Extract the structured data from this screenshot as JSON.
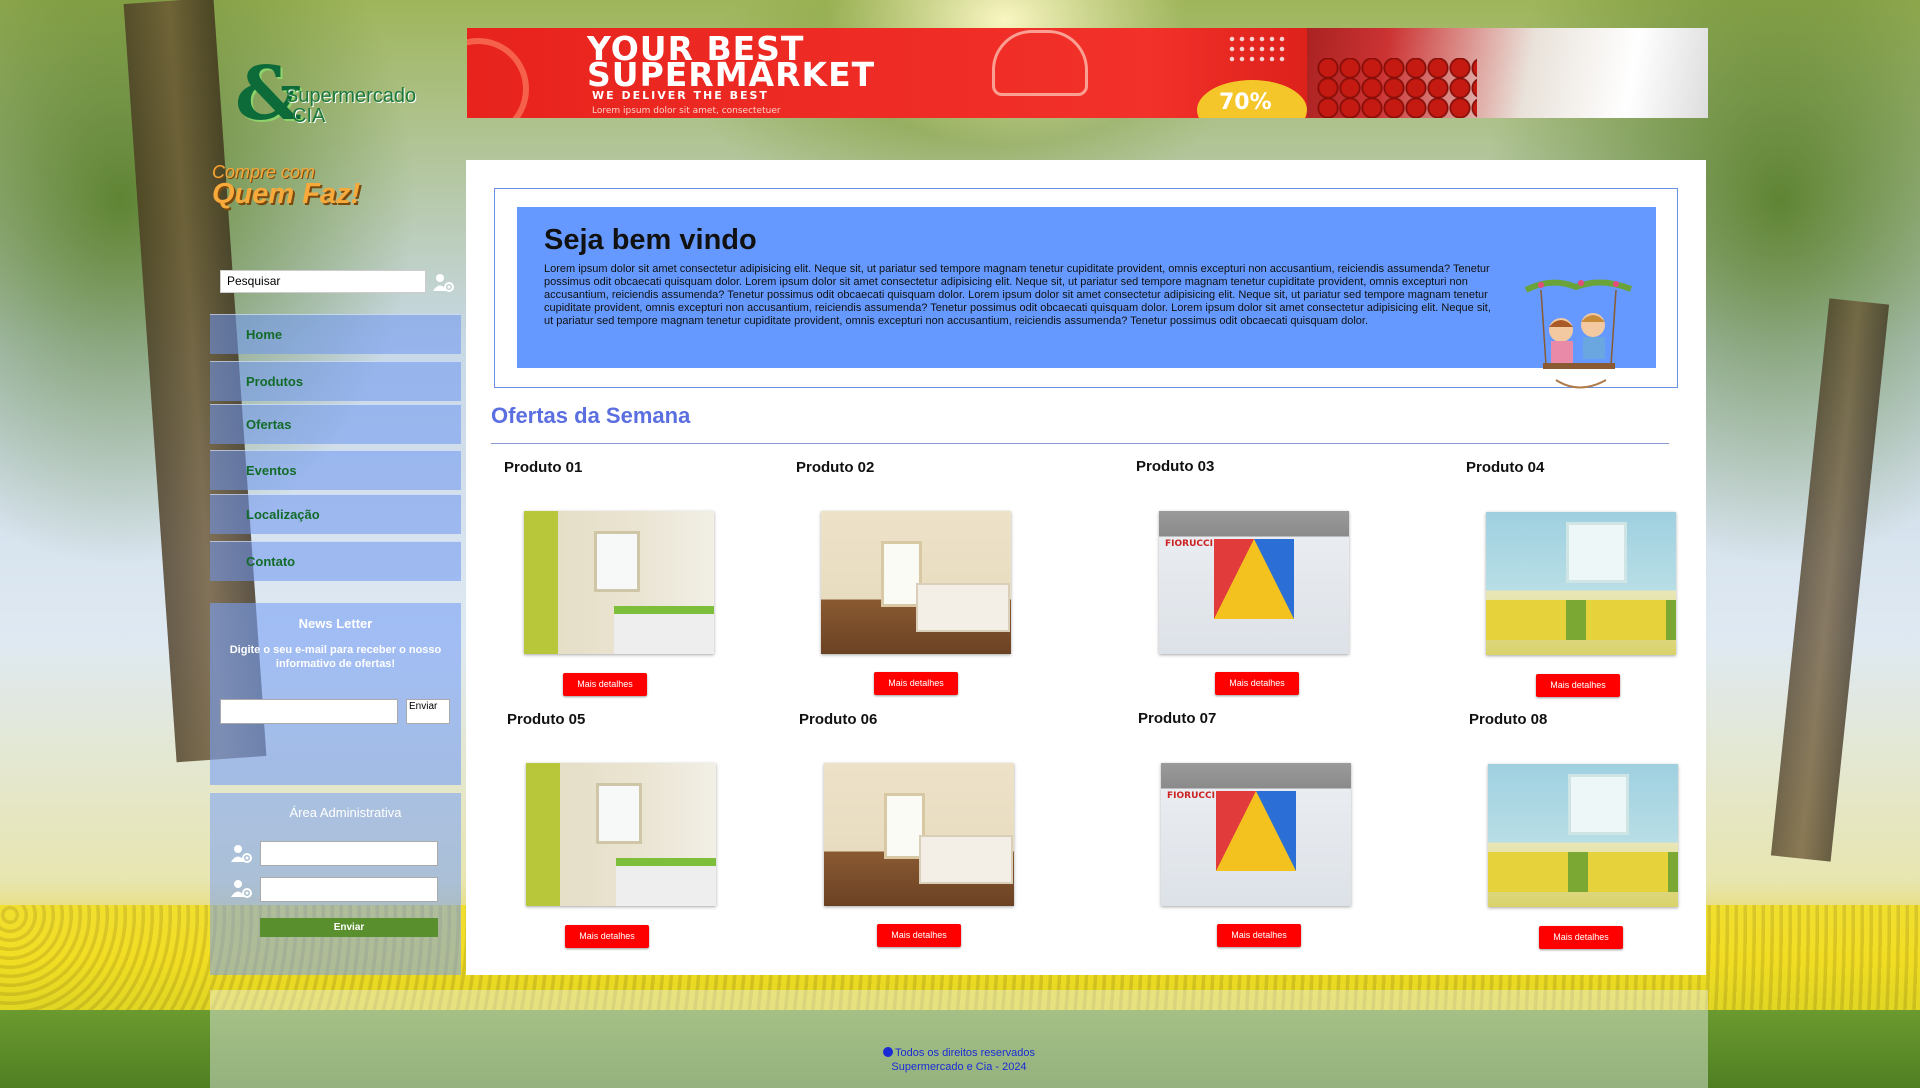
{
  "brand": {
    "logo_symbol": "&",
    "name_line1": "Supermercado",
    "name_line2": "CIA",
    "slogan_line1": "Compre com",
    "slogan_line2": "Quem Faz!"
  },
  "banner": {
    "line1": "YOUR BEST",
    "line2": "SUPERMARKET",
    "line3": "WE DELIVER THE BEST",
    "line4": "Lorem ipsum dolor sit amet, consectetuer",
    "badge": "70%"
  },
  "search": {
    "value": "Pesquisar",
    "icon": "search-icon"
  },
  "nav": {
    "items": [
      {
        "label": "Home"
      },
      {
        "label": "Produtos"
      },
      {
        "label": "Ofertas"
      },
      {
        "label": "Eventos"
      },
      {
        "label": "Localização"
      },
      {
        "label": "Contato"
      }
    ]
  },
  "newsletter": {
    "title": "News Letter",
    "text": "Digite o seu e-mail para receber o nosso informativo de ofertas!",
    "button": "Enviar"
  },
  "admin": {
    "title": "Área Administrativa",
    "button": "Enviar",
    "icon": "user-gear-icon"
  },
  "welcome": {
    "title": "Seja bem vindo",
    "text": "Lorem ipsum dolor sit amet consectetur adipisicing elit. Neque sit, ut pariatur sed tempore magnam tenetur cupiditate provident, omnis excepturi non accusantium, reiciendis assumenda? Tenetur possimus odit obcaecati quisquam dolor. Lorem ipsum dolor sit amet consectetur adipisicing elit. Neque sit, ut pariatur sed tempore magnam tenetur cupiditate provident, omnis excepturi non accusantium, reiciendis assumenda? Tenetur possimus odit obcaecati quisquam dolor. Lorem ipsum dolor sit amet consectetur adipisicing elit. Neque sit, ut pariatur sed tempore magnam tenetur cupiditate provident, omnis excepturi non accusantium, reiciendis assumenda? Tenetur possimus odit obcaecati quisquam dolor. Lorem ipsum dolor sit amet consectetur adipisicing elit. Neque sit, ut pariatur sed tempore magnam tenetur cupiditate provident, omnis excepturi non accusantium, reiciendis assumenda? Tenetur possimus odit obcaecati quisquam dolor."
  },
  "offers": {
    "title": "Ofertas da Semana",
    "products": [
      {
        "name": "Produto 01",
        "button": "Mais detalhes",
        "image": "bedroom-green"
      },
      {
        "name": "Produto 02",
        "button": "Mais detalhes",
        "image": "bedroom-wood"
      },
      {
        "name": "Produto 03",
        "button": "Mais detalhes",
        "image": "store-front"
      },
      {
        "name": "Produto 04",
        "button": "Mais detalhes",
        "image": "kids-bedroom"
      },
      {
        "name": "Produto 05",
        "button": "Mais detalhes",
        "image": "bedroom-green"
      },
      {
        "name": "Produto 06",
        "button": "Mais detalhes",
        "image": "bedroom-wood"
      },
      {
        "name": "Produto 07",
        "button": "Mais detalhes",
        "image": "store-front"
      },
      {
        "name": "Produto 08",
        "button": "Mais detalhes",
        "image": "kids-bedroom"
      }
    ]
  },
  "footer": {
    "line1": "Todos os direitos reservados",
    "line2": "Supermercado e Cia - 2024"
  }
}
